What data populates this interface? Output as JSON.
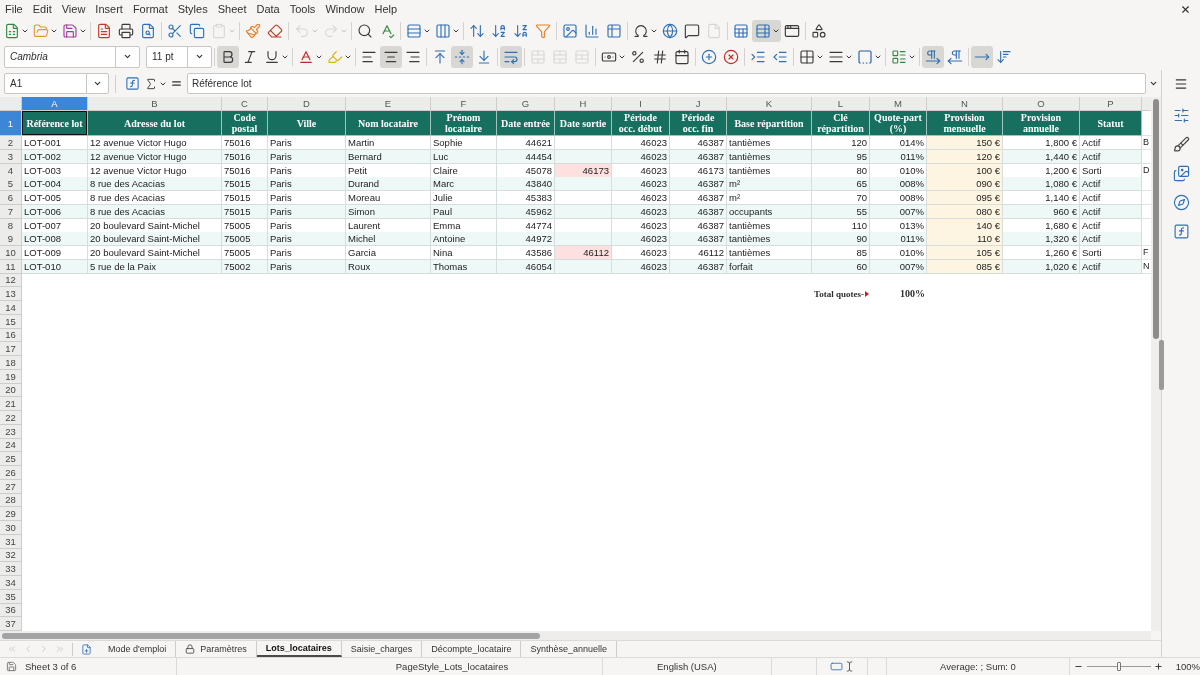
{
  "menu_bar": {
    "items": [
      "File",
      "Edit",
      "View",
      "Insert",
      "Format",
      "Styles",
      "Sheet",
      "Data",
      "Tools",
      "Window",
      "Help"
    ]
  },
  "standard_toolbar": [
    {
      "pressed": false,
      "disabled": false
    },
    {
      "pressed": false,
      "disabled": false
    },
    {
      "pressed": false,
      "disabled": false
    },
    {
      "pressed": false,
      "disabled": false
    },
    {
      "pressed": false,
      "disabled": false
    },
    {
      "pressed": false,
      "disabled": false
    },
    {
      "pressed": false,
      "disabled": false
    },
    {
      "pressed": false,
      "disabled": false
    },
    {
      "pressed": false,
      "disabled": true
    },
    {
      "pressed": false,
      "disabled": false
    },
    {
      "pressed": false,
      "disabled": false
    },
    {
      "pressed": false,
      "disabled": true
    },
    {
      "pressed": false,
      "disabled": true
    },
    {
      "pressed": false,
      "disabled": false
    },
    {
      "pressed": false,
      "disabled": false
    },
    {
      "pressed": false,
      "disabled": false
    },
    {
      "pressed": false,
      "disabled": false
    },
    {
      "pressed": false,
      "disabled": false
    },
    {
      "pressed": false,
      "disabled": false
    },
    {
      "pressed": false,
      "disabled": false
    },
    {
      "pressed": false,
      "disabled": false
    },
    {
      "pressed": false,
      "disabled": false
    },
    {
      "pressed": false,
      "disabled": false
    },
    {
      "pressed": false,
      "disabled": false
    },
    {
      "pressed": false,
      "disabled": false
    },
    {
      "pressed": false,
      "disabled": false
    },
    {
      "pressed": false,
      "disabled": false
    },
    {
      "pressed": false,
      "disabled": true
    },
    {
      "pressed": false,
      "disabled": false
    },
    {
      "pressed": true,
      "disabled": false
    },
    {
      "pressed": false,
      "disabled": false
    },
    {
      "pressed": false,
      "disabled": false
    }
  ],
  "formatting_toolbar": {
    "font_name": "Cambria",
    "font_size": "11 pt",
    "buttons": [
      {
        "pressed": true,
        "disabled": false
      },
      {
        "pressed": false,
        "disabled": false
      },
      {
        "pressed": false,
        "disabled": false
      },
      {
        "pressed": false,
        "disabled": false
      },
      {
        "pressed": false,
        "disabled": false
      },
      {
        "pressed": false,
        "disabled": false
      },
      {
        "pressed": true,
        "disabled": false
      },
      {
        "pressed": false,
        "disabled": false
      },
      {
        "pressed": false,
        "disabled": false
      },
      {
        "pressed": true,
        "disabled": false
      },
      {
        "pressed": false,
        "disabled": false
      },
      {
        "pressed": true,
        "disabled": false
      },
      {
        "pressed": false,
        "disabled": true
      },
      {
        "pressed": false,
        "disabled": true
      },
      {
        "pressed": false,
        "disabled": true
      },
      {
        "pressed": false,
        "disabled": false
      },
      {
        "pressed": false,
        "disabled": false
      },
      {
        "pressed": false,
        "disabled": false
      },
      {
        "pressed": false,
        "disabled": false
      },
      {
        "pressed": false,
        "disabled": false
      },
      {
        "pressed": false,
        "disabled": false
      },
      {
        "pressed": false,
        "disabled": false
      },
      {
        "pressed": false,
        "disabled": false
      },
      {
        "pressed": false,
        "disabled": false
      },
      {
        "pressed": false,
        "disabled": false
      },
      {
        "pressed": false,
        "disabled": false
      },
      {
        "pressed": false,
        "disabled": false
      },
      {
        "pressed": true,
        "disabled": false
      },
      {
        "pressed": false,
        "disabled": false
      },
      {
        "pressed": true,
        "disabled": false
      },
      {
        "pressed": false,
        "disabled": false
      }
    ]
  },
  "formula_bar": {
    "cell_reference": "A1",
    "content": "Référence lot"
  },
  "sheet": {
    "columns": [
      {
        "letter": "A",
        "selected": true,
        "highlighted": false
      },
      {
        "letter": "B",
        "selected": false,
        "highlighted": false
      },
      {
        "letter": "C",
        "selected": false,
        "highlighted": false
      },
      {
        "letter": "D",
        "selected": false,
        "highlighted": false
      },
      {
        "letter": "E",
        "selected": false,
        "highlighted": false
      },
      {
        "letter": "F",
        "selected": false,
        "highlighted": false
      },
      {
        "letter": "G",
        "selected": false,
        "highlighted": false
      },
      {
        "letter": "H",
        "selected": false,
        "highlighted": false
      },
      {
        "letter": "I",
        "selected": false,
        "highlighted": false
      },
      {
        "letter": "J",
        "selected": false,
        "highlighted": false
      },
      {
        "letter": "K",
        "selected": false,
        "highlighted": false
      },
      {
        "letter": "L",
        "selected": false,
        "highlighted": false
      },
      {
        "letter": "M",
        "selected": false,
        "highlighted": false
      },
      {
        "letter": "N",
        "selected": false,
        "highlighted": true
      },
      {
        "letter": "O",
        "selected": false,
        "highlighted": false
      },
      {
        "letter": "P",
        "selected": false,
        "highlighted": false
      }
    ],
    "row_headers": [
      {
        "label": "1",
        "selected": true
      },
      {
        "label": "2",
        "selected": false
      },
      {
        "label": "3",
        "selected": false
      },
      {
        "label": "4",
        "selected": false
      },
      {
        "label": "5",
        "selected": false
      },
      {
        "label": "6",
        "selected": false
      },
      {
        "label": "7",
        "selected": false
      },
      {
        "label": "8",
        "selected": false
      },
      {
        "label": "9",
        "selected": false
      },
      {
        "label": "10",
        "selected": false
      },
      {
        "label": "11",
        "selected": false
      },
      {
        "label": "12",
        "selected": false
      },
      {
        "label": "13",
        "selected": false
      },
      {
        "label": "14",
        "selected": false
      },
      {
        "label": "15",
        "selected": false
      },
      {
        "label": "16",
        "selected": false
      },
      {
        "label": "17",
        "selected": false
      },
      {
        "label": "18",
        "selected": false
      },
      {
        "label": "19",
        "selected": false
      },
      {
        "label": "20",
        "selected": false
      },
      {
        "label": "21",
        "selected": false
      },
      {
        "label": "22",
        "selected": false
      },
      {
        "label": "23",
        "selected": false
      },
      {
        "label": "24",
        "selected": false
      },
      {
        "label": "25",
        "selected": false
      },
      {
        "label": "26",
        "selected": false
      },
      {
        "label": "27",
        "selected": false
      },
      {
        "label": "28",
        "selected": false
      },
      {
        "label": "29",
        "selected": false
      },
      {
        "label": "30",
        "selected": false
      },
      {
        "label": "31",
        "selected": false
      },
      {
        "label": "32",
        "selected": false
      },
      {
        "label": "33",
        "selected": false
      },
      {
        "label": "34",
        "selected": false
      },
      {
        "label": "35",
        "selected": false
      },
      {
        "label": "36",
        "selected": false
      },
      {
        "label": "37",
        "selected": false
      }
    ],
    "header_row": [
      "Référence lot",
      "Adresse du lot",
      "Code postal",
      "Ville",
      "Nom locataire",
      "Prénom locataire",
      "Date entrée",
      "Date sortie",
      "Période occ. début",
      "Période occ. fin",
      "Base répartition",
      "Clé répartition",
      "Quote-part (%)",
      "Provision mensuelle",
      "Provision annuelle",
      "Statut"
    ],
    "rows": [
      {
        "cells": [
          "LOT-001",
          "12 avenue Victor Hugo",
          "75016",
          "Paris",
          "Martin",
          "Sophie",
          "44621",
          null,
          "46023",
          "46387",
          "tantièmes",
          "120",
          "014%",
          "150 €",
          "1,800 €",
          "Actif"
        ],
        "exit_highlighted": false,
        "column_17": "B"
      },
      {
        "cells": [
          "LOT-002",
          "12 avenue Victor Hugo",
          "75016",
          "Paris",
          "Bernard",
          "Luc",
          "44454",
          null,
          "46023",
          "46387",
          "tantièmes",
          "95",
          "011%",
          "120 €",
          "1,440 €",
          "Actif"
        ],
        "exit_highlighted": false
      },
      {
        "cells": [
          "LOT-003",
          "12 avenue Victor Hugo",
          "75016",
          "Paris",
          "Petit",
          "Claire",
          "45078",
          "46173",
          "46023",
          "46173",
          "tantièmes",
          "80",
          "010%",
          "100 €",
          "1,200 €",
          "Sorti"
        ],
        "exit_highlighted": true,
        "column_17": "D"
      },
      {
        "cells": [
          "LOT-004",
          "8 rue des Acacias",
          "75015",
          "Paris",
          "Durand",
          "Marc",
          "43840",
          null,
          "46023",
          "46387",
          "m²",
          "65",
          "008%",
          "090 €",
          "1,080 €",
          "Actif"
        ],
        "exit_highlighted": false
      },
      {
        "cells": [
          "LOT-005",
          "8 rue des Acacias",
          "75015",
          "Paris",
          "Moreau",
          "Julie",
          "45383",
          null,
          "46023",
          "46387",
          "m²",
          "70",
          "008%",
          "095 €",
          "1,140 €",
          "Actif"
        ],
        "exit_highlighted": false
      },
      {
        "cells": [
          "LOT-006",
          "8 rue des Acacias",
          "75015",
          "Paris",
          "Simon",
          "Paul",
          "45962",
          null,
          "46023",
          "46387",
          "occupants",
          "55",
          "007%",
          "080 €",
          "960 €",
          "Actif"
        ],
        "exit_highlighted": false
      },
      {
        "cells": [
          "LOT-007",
          "20 boulevard Saint-Michel",
          "75005",
          "Paris",
          "Laurent",
          "Emma",
          "44774",
          null,
          "46023",
          "46387",
          "tantièmes",
          "110",
          "013%",
          "140 €",
          "1,680 €",
          "Actif"
        ],
        "exit_highlighted": false
      },
      {
        "cells": [
          "LOT-008",
          "20 boulevard Saint-Michel",
          "75005",
          "Paris",
          "Michel",
          "Antoine",
          "44972",
          null,
          "46023",
          "46387",
          "tantièmes",
          "90",
          "011%",
          "110 €",
          "1,320 €",
          "Actif"
        ],
        "exit_highlighted": false
      },
      {
        "cells": [
          "LOT-009",
          "20 boulevard Saint-Michel",
          "75005",
          "Paris",
          "Garcia",
          "Nina",
          "43586",
          "46112",
          "46023",
          "46112",
          "tantièmes",
          "85",
          "010%",
          "105 €",
          "1,260 €",
          "Sorti"
        ],
        "exit_highlighted": true,
        "column_17": "F"
      },
      {
        "cells": [
          "LOT-010",
          "5 rue de la Paix",
          "75002",
          "Paris",
          "Roux",
          "Thomas",
          "46054",
          null,
          "46023",
          "46387",
          "forfait",
          "60",
          "007%",
          "085 €",
          "1,020 €",
          "Actif"
        ],
        "exit_highlighted": false,
        "column_17": "N"
      }
    ],
    "summary": {
      "label": "Total quotes-",
      "value": "100%"
    }
  },
  "sheet_navigation": [
    {
      "disabled": true
    },
    {
      "disabled": true
    },
    {
      "disabled": true
    },
    {
      "disabled": true
    }
  ],
  "sheet_tabs": [
    {
      "label": "Mode d'emploi",
      "selected": false,
      "locked": false
    },
    {
      "label": "Paramètres",
      "selected": false,
      "locked": true
    },
    {
      "label": "Lots_locataires",
      "selected": true,
      "locked": false
    },
    {
      "label": "Saisie_charges",
      "selected": false,
      "locked": false
    },
    {
      "label": "Décompte_locataire",
      "selected": false,
      "locked": false
    },
    {
      "label": "Synthèse_annuelle",
      "selected": false,
      "locked": false
    }
  ],
  "status_bar": {
    "sheet": "Sheet 3 of 6",
    "page_style": "PageStyle_Lots_locataires",
    "language": "English (USA)",
    "selection_summary": "Average: ; Sum: 0",
    "zoom": {
      "level": 0.5,
      "label": "100%"
    }
  }
}
